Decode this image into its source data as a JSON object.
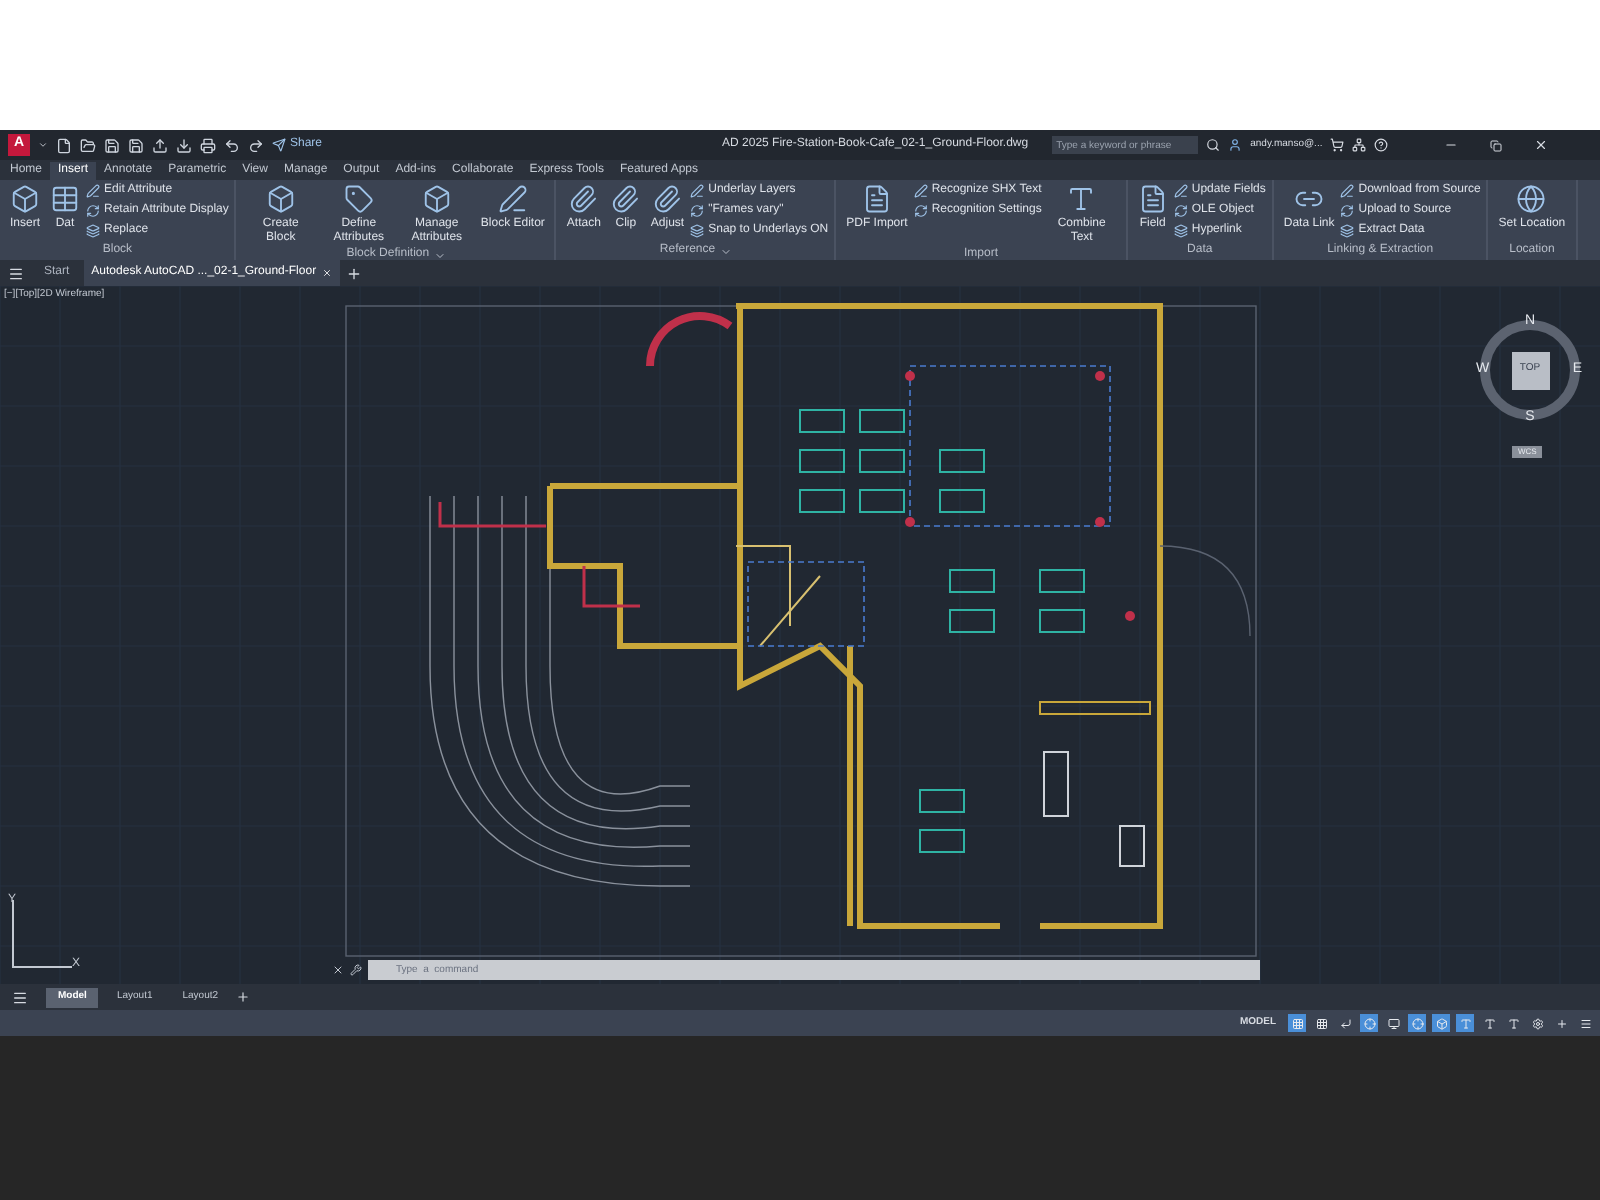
{
  "title_bar": {
    "app_icon": "A",
    "share": "Share",
    "title": "AD 2025 Fire-Station-Book-Cafe_02-1_Ground-Floor.dwg",
    "search": {
      "placeholder": "Type a keyword or phrase"
    },
    "user": "andy.manso@..."
  },
  "ribbon_tabs": [
    {
      "label": "Home",
      "selected": false
    },
    {
      "label": "Insert",
      "selected": true
    },
    {
      "label": "Annotate",
      "selected": false
    },
    {
      "label": "Parametric",
      "selected": false
    },
    {
      "label": "View",
      "selected": false
    },
    {
      "label": "Manage",
      "selected": false
    },
    {
      "label": "Output",
      "selected": false
    },
    {
      "label": "Add-ins",
      "selected": false
    },
    {
      "label": "Collaborate",
      "selected": false
    },
    {
      "label": "Express Tools",
      "selected": false
    },
    {
      "label": "Featured Apps",
      "selected": false
    }
  ],
  "ribbon_panels": [
    {
      "title": "Block",
      "menu": false,
      "large": [
        {
          "label": "Insert",
          "kind": "insert"
        },
        {
          "label": "Dat",
          "kind": "data"
        }
      ],
      "small": [
        "Edit Attribute",
        "Retain Attribute Display",
        "Replace"
      ]
    },
    {
      "title": "Block Definition",
      "menu": true,
      "large": [
        {
          "label": "Create Block",
          "kind": "block"
        },
        {
          "label": "Define Attributes",
          "kind": "tag"
        },
        {
          "label": "Manage Attributes",
          "kind": "block"
        },
        {
          "label": "Block Editor",
          "kind": "edit"
        }
      ]
    },
    {
      "title": "Reference",
      "menu": true,
      "large": [
        {
          "label": "Attach",
          "kind": "clip"
        },
        {
          "label": "Clip",
          "kind": "clip"
        },
        {
          "label": "Adjust",
          "kind": "clip"
        }
      ],
      "small": [
        "Underlay Layers",
        "\"Frames vary\"",
        "Snap to Underlays ON"
      ]
    },
    {
      "title": "Import",
      "menu": false,
      "large": [
        {
          "label": "PDF Import",
          "kind": "pdf"
        }
      ],
      "small": [
        "Recognize SHX Text",
        "Recognition Settings"
      ],
      "after": [
        {
          "label": "Combine Text",
          "kind": "text"
        }
      ]
    },
    {
      "title": "Data",
      "menu": false,
      "large": [
        {
          "label": "Field",
          "kind": "field"
        }
      ],
      "small": [
        "Update Fields",
        "OLE Object",
        "Hyperlink"
      ]
    },
    {
      "title": "Linking & Extraction",
      "menu": false,
      "large": [
        {
          "label": "Data Link",
          "kind": "link"
        }
      ],
      "small": [
        "Download from Source",
        "Upload to Source",
        "Extract  Data"
      ]
    },
    {
      "title": "Location",
      "menu": false,
      "large": [
        {
          "label": "Set Location",
          "kind": "globe"
        }
      ]
    }
  ],
  "file_tabs": [
    {
      "label": "Start",
      "selected": false
    },
    {
      "label": "Autodesk AutoCAD ..._02-1_Ground-Floor",
      "selected": true
    }
  ],
  "viewport": {
    "label": "[−][Top][2D Wireframe]",
    "compass": {
      "n": "N",
      "e": "E",
      "s": "S",
      "w": "W",
      "top": "TOP"
    },
    "wcs": "WCS",
    "ucs": {
      "y": "Y",
      "x": "X"
    }
  },
  "command_line": {
    "placeholder": "Type  a  command"
  },
  "layout_tabs": [
    {
      "label": "Model",
      "selected": true
    },
    {
      "label": "Layout1",
      "selected": false
    },
    {
      "label": "Layout2",
      "selected": false
    }
  ],
  "status_bar": {
    "model": "MODEL",
    "toggles": [
      {
        "kind": "grid",
        "on": true
      },
      {
        "kind": "snap",
        "on": false
      },
      {
        "kind": "ortho",
        "on": false
      },
      {
        "kind": "polar",
        "on": true
      },
      {
        "kind": "iso",
        "on": false
      },
      {
        "kind": "track",
        "on": true
      },
      {
        "kind": "osnap",
        "on": true
      },
      {
        "kind": "anno",
        "on": true
      },
      {
        "kind": "anno",
        "on": false
      },
      {
        "kind": "anno",
        "on": false
      },
      {
        "kind": "gear",
        "on": false
      },
      {
        "kind": "plus",
        "on": false
      },
      {
        "kind": "custom",
        "on": false
      }
    ]
  }
}
